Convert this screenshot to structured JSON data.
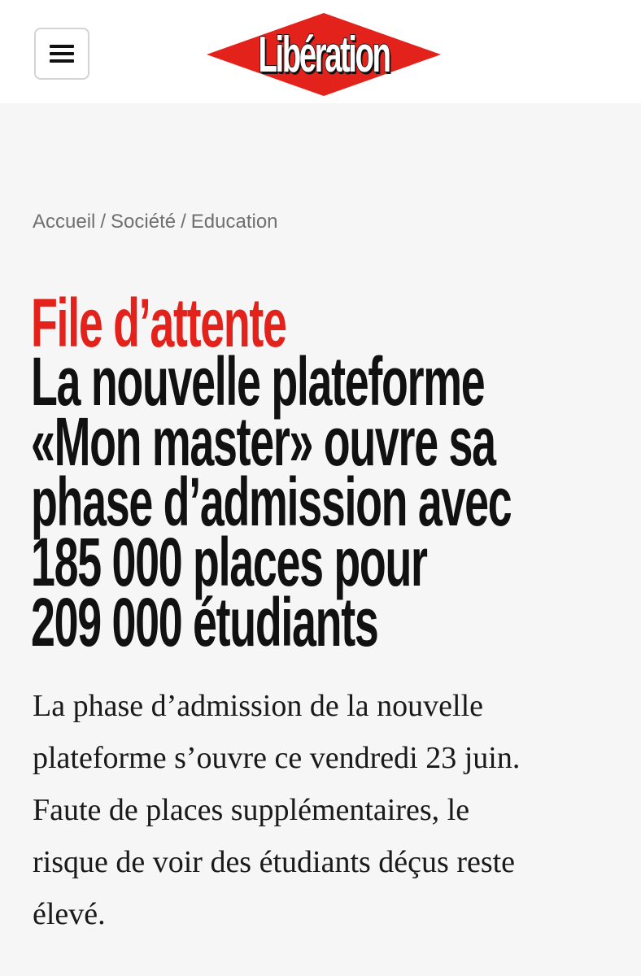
{
  "header": {
    "menu_icon": "hamburger-menu-icon",
    "logo_text": "Libération",
    "logo_colors": {
      "diamond": "#e3231b",
      "text": "#ffffff",
      "outline": "#111111"
    }
  },
  "breadcrumb": {
    "items": [
      "Accueil",
      "Société",
      "Education"
    ],
    "separator": "/"
  },
  "article": {
    "kicker": "File d’attente",
    "title_lines": [
      "La nouvelle plateforme",
      "«Mon master» ouvre sa",
      "phase d’admission avec",
      "185 000 places pour",
      "209 000 étudiants"
    ],
    "lede_lines": [
      "La phase d’admission de la nouvelle",
      "plateforme s’ouvre ce vendredi 23 juin.",
      "Faute de places supplémentaires, le",
      "risque de voir des étudiants déçus reste",
      "élevé."
    ]
  },
  "colors": {
    "accent_red": "#e3231b",
    "page_background": "#f6f6f6",
    "header_background": "#ffffff",
    "breadcrumb_text": "#707070"
  }
}
